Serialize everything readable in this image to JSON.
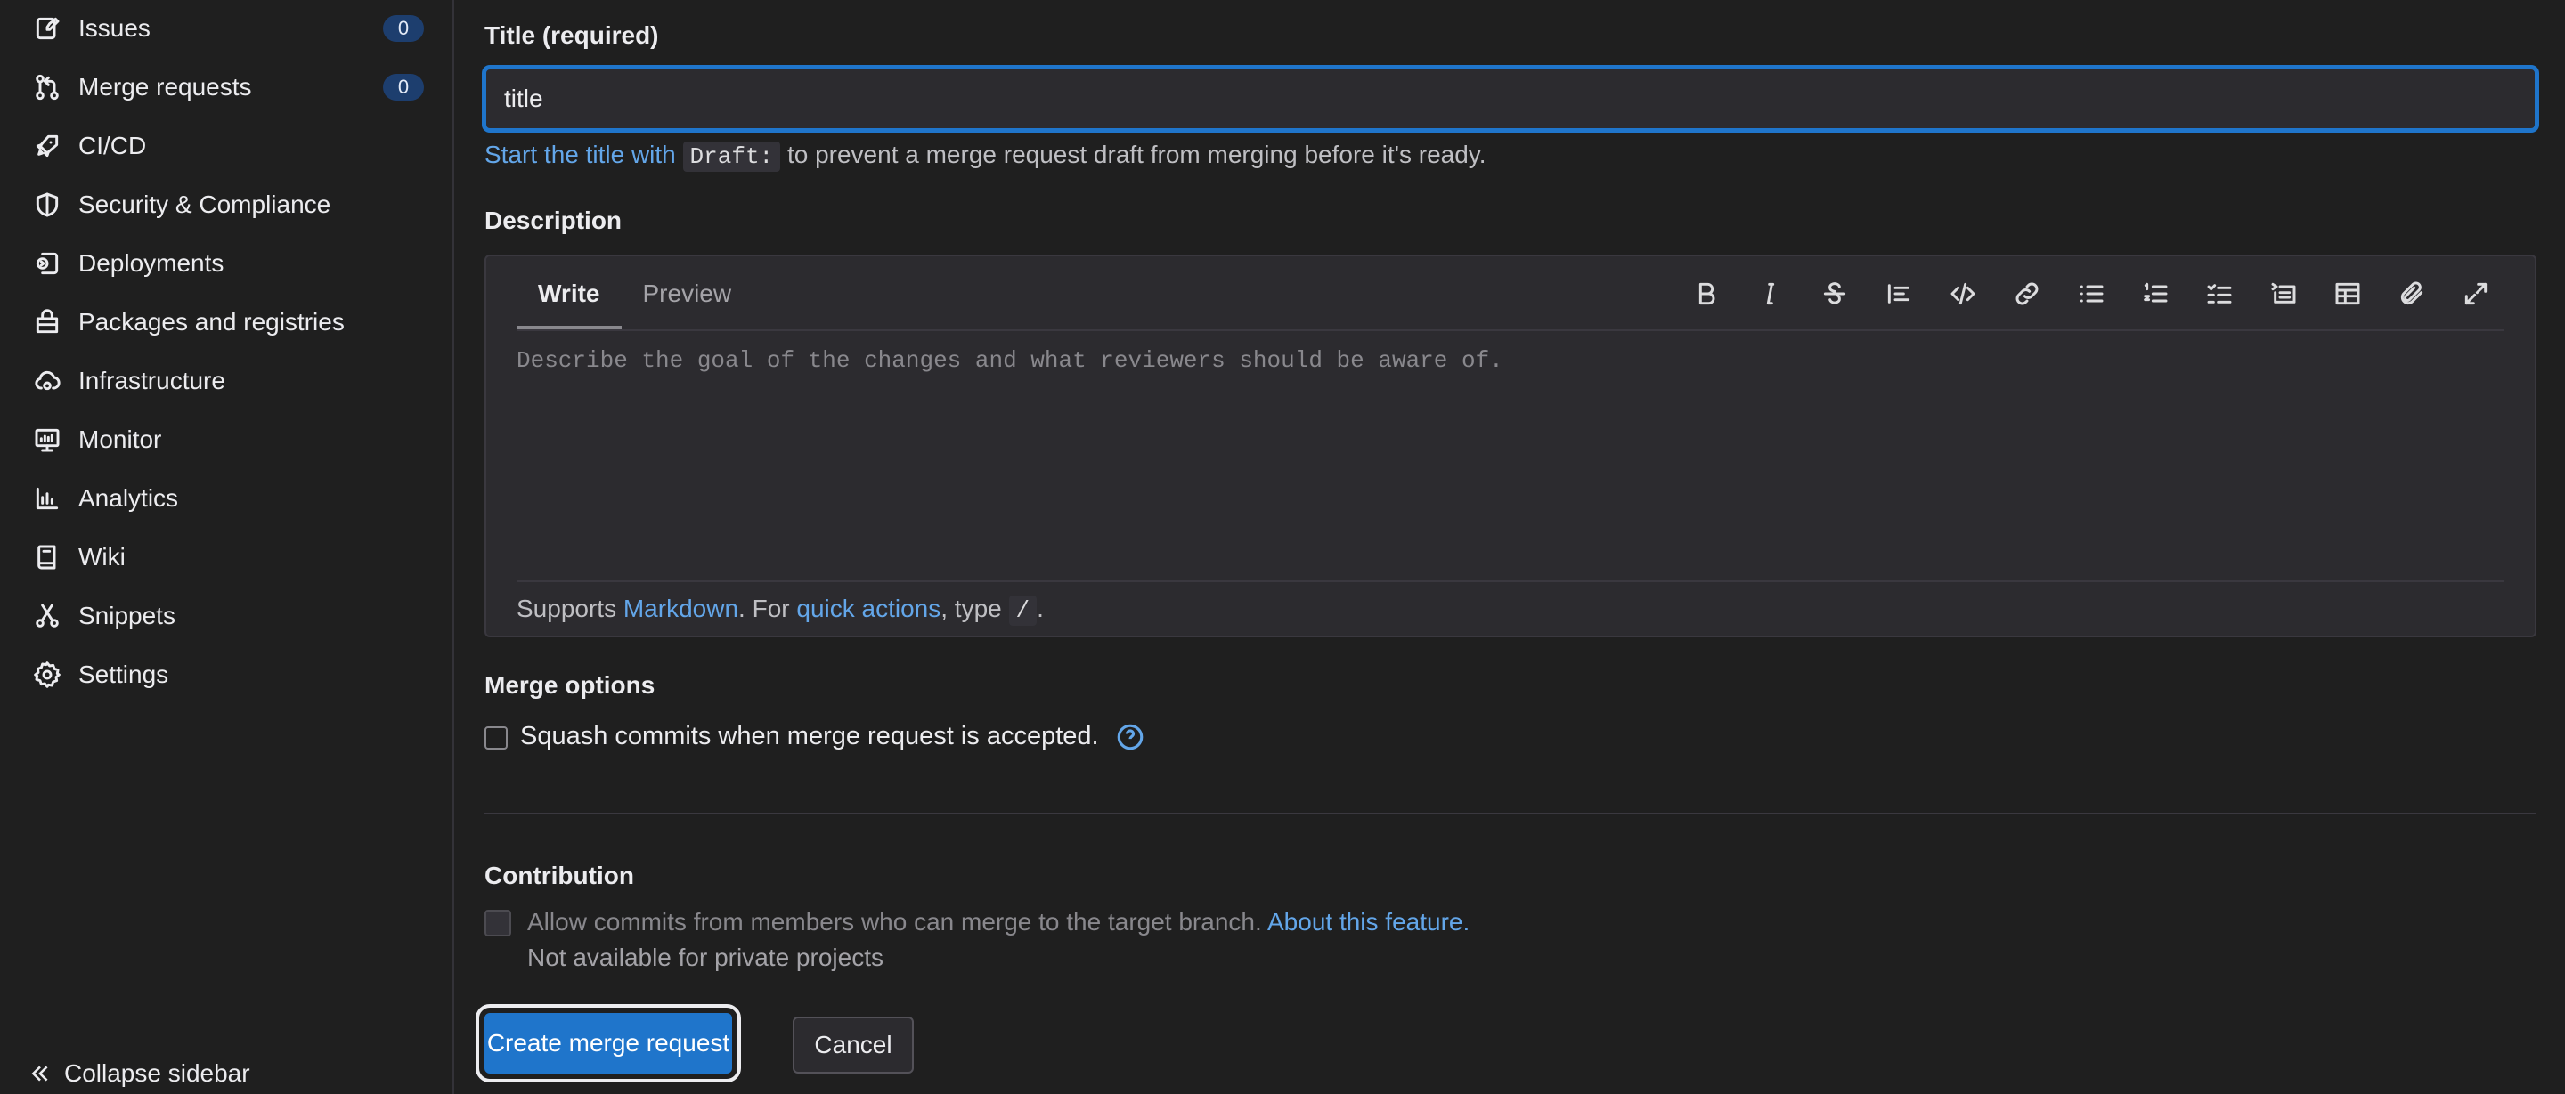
{
  "sidebar": {
    "items": [
      {
        "label": "Issues",
        "icon": "issues-icon",
        "badge": "0"
      },
      {
        "label": "Merge requests",
        "icon": "merge-request-icon",
        "badge": "0"
      },
      {
        "label": "CI/CD",
        "icon": "rocket-icon"
      },
      {
        "label": "Security & Compliance",
        "icon": "shield-icon"
      },
      {
        "label": "Deployments",
        "icon": "deployments-icon"
      },
      {
        "label": "Packages and registries",
        "icon": "package-icon"
      },
      {
        "label": "Infrastructure",
        "icon": "cloud-gear-icon"
      },
      {
        "label": "Monitor",
        "icon": "monitor-icon"
      },
      {
        "label": "Analytics",
        "icon": "chart-icon"
      },
      {
        "label": "Wiki",
        "icon": "book-icon"
      },
      {
        "label": "Snippets",
        "icon": "scissors-icon"
      },
      {
        "label": "Settings",
        "icon": "gear-icon"
      }
    ],
    "collapse_label": "Collapse sidebar"
  },
  "form": {
    "title_label": "Title (required)",
    "title_value": "title",
    "hint_prefix": "Start the title with",
    "hint_code": "Draft:",
    "hint_suffix": "to prevent a merge request draft from merging before it's ready.",
    "description_label": "Description",
    "tabs": [
      {
        "label": "Write"
      },
      {
        "label": "Preview"
      }
    ],
    "description_placeholder": "Describe the goal of the changes and what reviewers should be aware of.",
    "footer": {
      "supports": "Supports",
      "markdown": "Markdown",
      "for": ". For",
      "quick_actions": "quick actions",
      "type": ", type",
      "slash": "/",
      "end": "."
    },
    "merge_options_label": "Merge options",
    "squash_label": "Squash commits when merge request is accepted.",
    "contribution_label": "Contribution",
    "allow_commits_label": "Allow commits from members who can merge to the target branch.",
    "about_link": "About this feature.",
    "not_available": "Not available for private projects",
    "create_button": "Create merge request",
    "cancel_button": "Cancel"
  },
  "colors": {
    "accent": "#1f75cb",
    "link": "#63a6e9",
    "background": "#1f1f1f",
    "badge_bg": "#1d3e6e"
  }
}
